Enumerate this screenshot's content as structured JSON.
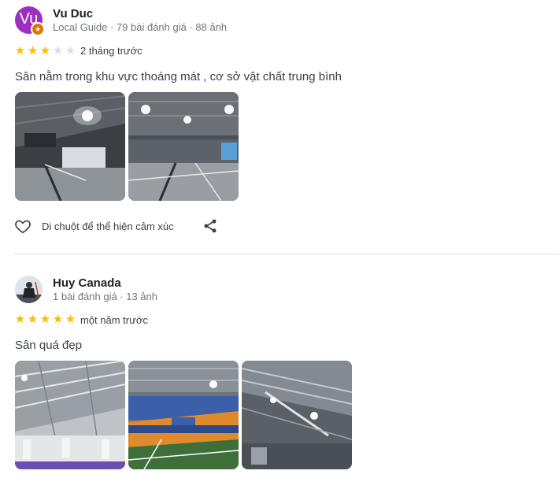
{
  "reviews": [
    {
      "reviewer_name": "Vu Duc",
      "avatar_initials": "Vu",
      "avatar_color": "#9b2fc0",
      "meta": "Local Guide · 79 bài đánh giá · 88 ảnh",
      "rating": 3,
      "rating_max": 5,
      "time": "2 tháng trước",
      "text": "Sân nằm trong khu vực thoáng mát , cơ sở vật chất trung bình",
      "photos": [
        "court-photo",
        "court-photo"
      ],
      "like_label": "Di chuột để thể hiện cảm xúc"
    },
    {
      "reviewer_name": "Huy Canada",
      "meta": "1 bài đánh giá · 13 ảnh",
      "rating": 5,
      "rating_max": 5,
      "time": "một năm trước",
      "text": "Sân quá đẹp",
      "photos": [
        "court-photo",
        "court-photo",
        "court-photo"
      ]
    }
  ],
  "colors": {
    "star_on": "#fbbc04",
    "star_off": "#dadce0",
    "divider": "#dadce0"
  }
}
